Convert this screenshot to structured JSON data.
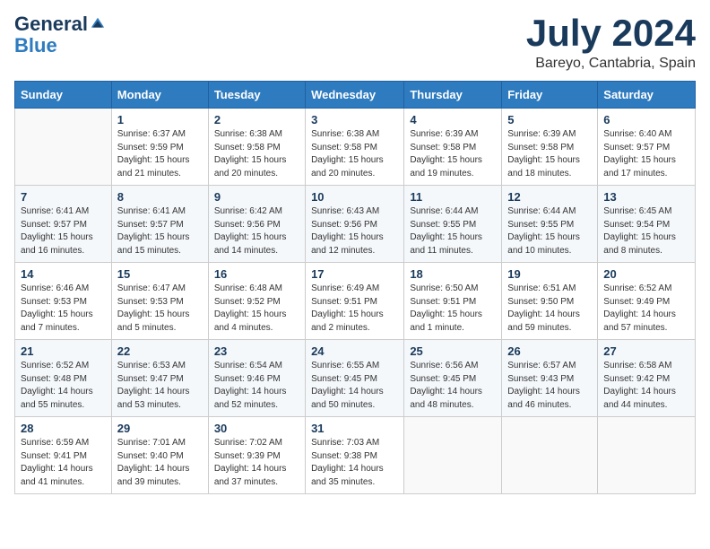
{
  "header": {
    "logo_general": "General",
    "logo_blue": "Blue",
    "month_year": "July 2024",
    "location": "Bareyo, Cantabria, Spain"
  },
  "days_of_week": [
    "Sunday",
    "Monday",
    "Tuesday",
    "Wednesday",
    "Thursday",
    "Friday",
    "Saturday"
  ],
  "weeks": [
    [
      {
        "day": "",
        "sunrise": "",
        "sunset": "",
        "daylight": ""
      },
      {
        "day": "1",
        "sunrise": "Sunrise: 6:37 AM",
        "sunset": "Sunset: 9:59 PM",
        "daylight": "Daylight: 15 hours and 21 minutes."
      },
      {
        "day": "2",
        "sunrise": "Sunrise: 6:38 AM",
        "sunset": "Sunset: 9:58 PM",
        "daylight": "Daylight: 15 hours and 20 minutes."
      },
      {
        "day": "3",
        "sunrise": "Sunrise: 6:38 AM",
        "sunset": "Sunset: 9:58 PM",
        "daylight": "Daylight: 15 hours and 20 minutes."
      },
      {
        "day": "4",
        "sunrise": "Sunrise: 6:39 AM",
        "sunset": "Sunset: 9:58 PM",
        "daylight": "Daylight: 15 hours and 19 minutes."
      },
      {
        "day": "5",
        "sunrise": "Sunrise: 6:39 AM",
        "sunset": "Sunset: 9:58 PM",
        "daylight": "Daylight: 15 hours and 18 minutes."
      },
      {
        "day": "6",
        "sunrise": "Sunrise: 6:40 AM",
        "sunset": "Sunset: 9:57 PM",
        "daylight": "Daylight: 15 hours and 17 minutes."
      }
    ],
    [
      {
        "day": "7",
        "sunrise": "Sunrise: 6:41 AM",
        "sunset": "Sunset: 9:57 PM",
        "daylight": "Daylight: 15 hours and 16 minutes."
      },
      {
        "day": "8",
        "sunrise": "Sunrise: 6:41 AM",
        "sunset": "Sunset: 9:57 PM",
        "daylight": "Daylight: 15 hours and 15 minutes."
      },
      {
        "day": "9",
        "sunrise": "Sunrise: 6:42 AM",
        "sunset": "Sunset: 9:56 PM",
        "daylight": "Daylight: 15 hours and 14 minutes."
      },
      {
        "day": "10",
        "sunrise": "Sunrise: 6:43 AM",
        "sunset": "Sunset: 9:56 PM",
        "daylight": "Daylight: 15 hours and 12 minutes."
      },
      {
        "day": "11",
        "sunrise": "Sunrise: 6:44 AM",
        "sunset": "Sunset: 9:55 PM",
        "daylight": "Daylight: 15 hours and 11 minutes."
      },
      {
        "day": "12",
        "sunrise": "Sunrise: 6:44 AM",
        "sunset": "Sunset: 9:55 PM",
        "daylight": "Daylight: 15 hours and 10 minutes."
      },
      {
        "day": "13",
        "sunrise": "Sunrise: 6:45 AM",
        "sunset": "Sunset: 9:54 PM",
        "daylight": "Daylight: 15 hours and 8 minutes."
      }
    ],
    [
      {
        "day": "14",
        "sunrise": "Sunrise: 6:46 AM",
        "sunset": "Sunset: 9:53 PM",
        "daylight": "Daylight: 15 hours and 7 minutes."
      },
      {
        "day": "15",
        "sunrise": "Sunrise: 6:47 AM",
        "sunset": "Sunset: 9:53 PM",
        "daylight": "Daylight: 15 hours and 5 minutes."
      },
      {
        "day": "16",
        "sunrise": "Sunrise: 6:48 AM",
        "sunset": "Sunset: 9:52 PM",
        "daylight": "Daylight: 15 hours and 4 minutes."
      },
      {
        "day": "17",
        "sunrise": "Sunrise: 6:49 AM",
        "sunset": "Sunset: 9:51 PM",
        "daylight": "Daylight: 15 hours and 2 minutes."
      },
      {
        "day": "18",
        "sunrise": "Sunrise: 6:50 AM",
        "sunset": "Sunset: 9:51 PM",
        "daylight": "Daylight: 15 hours and 1 minute."
      },
      {
        "day": "19",
        "sunrise": "Sunrise: 6:51 AM",
        "sunset": "Sunset: 9:50 PM",
        "daylight": "Daylight: 14 hours and 59 minutes."
      },
      {
        "day": "20",
        "sunrise": "Sunrise: 6:52 AM",
        "sunset": "Sunset: 9:49 PM",
        "daylight": "Daylight: 14 hours and 57 minutes."
      }
    ],
    [
      {
        "day": "21",
        "sunrise": "Sunrise: 6:52 AM",
        "sunset": "Sunset: 9:48 PM",
        "daylight": "Daylight: 14 hours and 55 minutes."
      },
      {
        "day": "22",
        "sunrise": "Sunrise: 6:53 AM",
        "sunset": "Sunset: 9:47 PM",
        "daylight": "Daylight: 14 hours and 53 minutes."
      },
      {
        "day": "23",
        "sunrise": "Sunrise: 6:54 AM",
        "sunset": "Sunset: 9:46 PM",
        "daylight": "Daylight: 14 hours and 52 minutes."
      },
      {
        "day": "24",
        "sunrise": "Sunrise: 6:55 AM",
        "sunset": "Sunset: 9:45 PM",
        "daylight": "Daylight: 14 hours and 50 minutes."
      },
      {
        "day": "25",
        "sunrise": "Sunrise: 6:56 AM",
        "sunset": "Sunset: 9:45 PM",
        "daylight": "Daylight: 14 hours and 48 minutes."
      },
      {
        "day": "26",
        "sunrise": "Sunrise: 6:57 AM",
        "sunset": "Sunset: 9:43 PM",
        "daylight": "Daylight: 14 hours and 46 minutes."
      },
      {
        "day": "27",
        "sunrise": "Sunrise: 6:58 AM",
        "sunset": "Sunset: 9:42 PM",
        "daylight": "Daylight: 14 hours and 44 minutes."
      }
    ],
    [
      {
        "day": "28",
        "sunrise": "Sunrise: 6:59 AM",
        "sunset": "Sunset: 9:41 PM",
        "daylight": "Daylight: 14 hours and 41 minutes."
      },
      {
        "day": "29",
        "sunrise": "Sunrise: 7:01 AM",
        "sunset": "Sunset: 9:40 PM",
        "daylight": "Daylight: 14 hours and 39 minutes."
      },
      {
        "day": "30",
        "sunrise": "Sunrise: 7:02 AM",
        "sunset": "Sunset: 9:39 PM",
        "daylight": "Daylight: 14 hours and 37 minutes."
      },
      {
        "day": "31",
        "sunrise": "Sunrise: 7:03 AM",
        "sunset": "Sunset: 9:38 PM",
        "daylight": "Daylight: 14 hours and 35 minutes."
      },
      {
        "day": "",
        "sunrise": "",
        "sunset": "",
        "daylight": ""
      },
      {
        "day": "",
        "sunrise": "",
        "sunset": "",
        "daylight": ""
      },
      {
        "day": "",
        "sunrise": "",
        "sunset": "",
        "daylight": ""
      }
    ]
  ]
}
